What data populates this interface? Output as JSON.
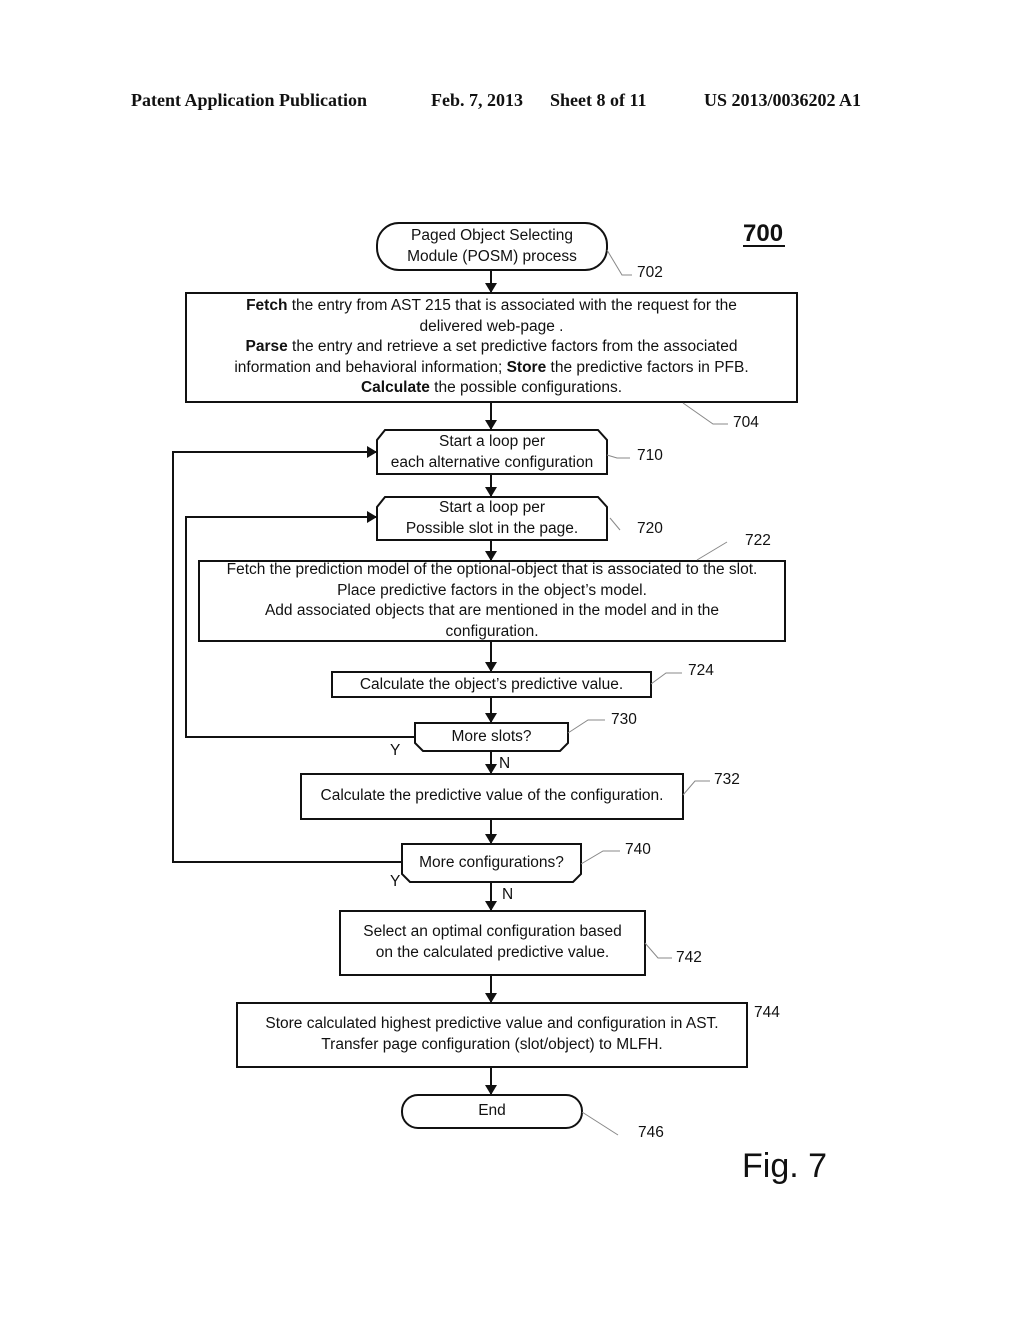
{
  "header": {
    "publication": "Patent Application Publication",
    "date": "Feb. 7, 2013",
    "sheet": "Sheet 8 of 11",
    "patent_number": "US 2013/0036202 A1"
  },
  "figure": {
    "number_label": "700",
    "caption": "Fig. 7"
  },
  "nodes": {
    "start": {
      "ref": "702",
      "lines": [
        "Paged Object Selecting",
        "Module (POSM) process"
      ]
    },
    "fetch_entry": {
      "ref": "704",
      "line1_bold": "Fetch",
      "line1_rest": " the entry from AST 215 that is associated with the request for the",
      "line2": "delivered web-page .",
      "line3_bold": "Parse",
      "line3_rest": " the entry and retrieve a set predictive factors from the associated",
      "line4_pre": "information and behavioral information; ",
      "line4_bold": "Store",
      "line4_rest": "  the predictive factors in PFB.",
      "line5_bold": "Calculate",
      "line5_rest": " the possible configurations."
    },
    "loop_config": {
      "ref": "710",
      "lines": [
        "Start a loop per",
        "each alternative configuration"
      ]
    },
    "loop_slot": {
      "ref": "720",
      "lines": [
        "Start a loop per",
        "Possible slot in the page."
      ]
    },
    "fetch_model": {
      "ref": "722",
      "lines": [
        "Fetch the prediction model of the optional-object that is associated to the slot.",
        "Place predictive factors in the object’s model.",
        "Add associated objects that are mentioned in the model and in the",
        "configuration."
      ]
    },
    "calc_object": {
      "ref": "724",
      "text": "Calculate the object’s predictive value."
    },
    "more_slots": {
      "ref": "730",
      "text": "More slots?",
      "yes": "Y",
      "no": "N"
    },
    "calc_config": {
      "ref": "732",
      "text": "Calculate the predictive value of the configuration."
    },
    "more_configs": {
      "ref": "740",
      "text": "More configurations?",
      "yes": "Y",
      "no": "N"
    },
    "select_optimal": {
      "ref": "742",
      "lines": [
        "Select an optimal configuration based",
        "on the calculated predictive value."
      ]
    },
    "store_result": {
      "ref": "744",
      "lines": [
        "Store calculated highest predictive value and configuration in AST.",
        "Transfer page configuration (slot/object) to MLFH."
      ]
    },
    "end": {
      "ref": "746",
      "text": "End"
    }
  }
}
